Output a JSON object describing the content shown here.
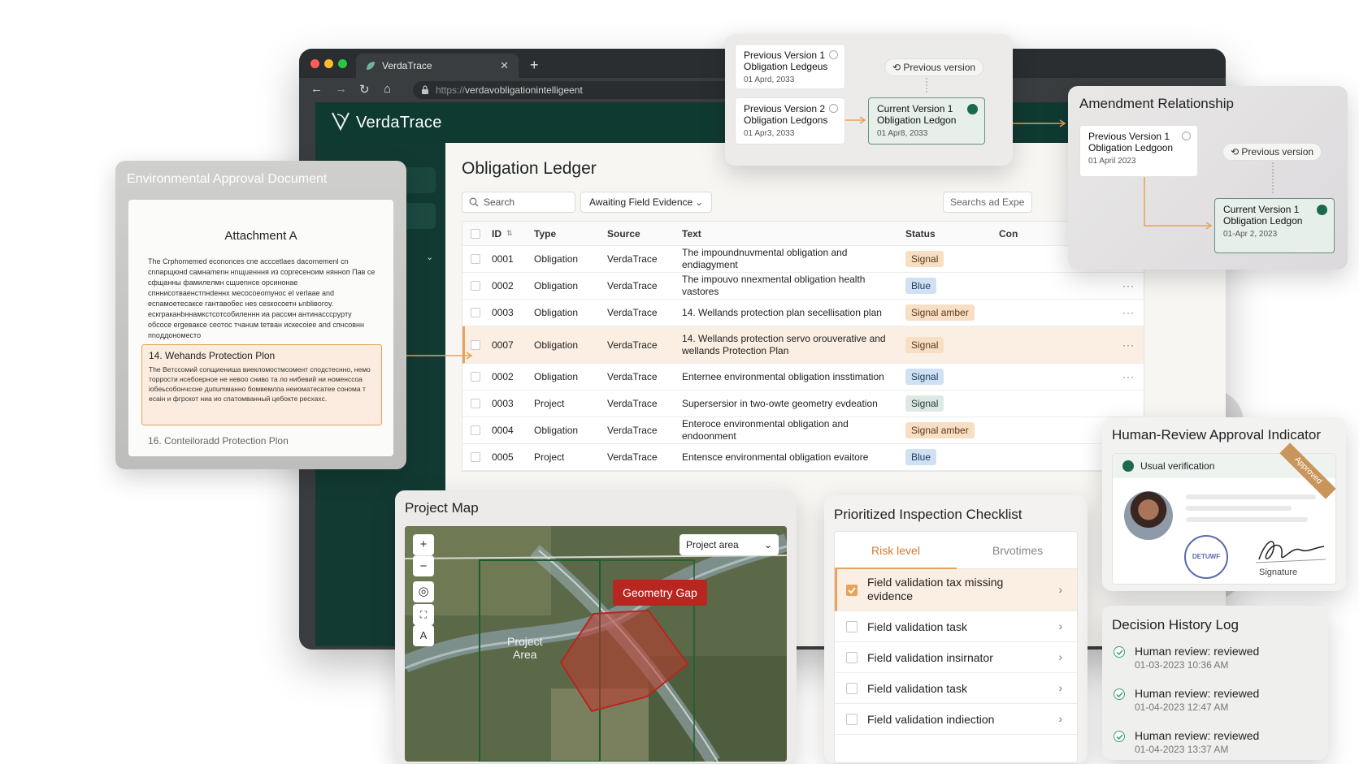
{
  "browser": {
    "tab_title": "VerdaTrace",
    "url_prefix": "https://",
    "url_rest": "verdavobligationintelligeent"
  },
  "app": {
    "brand": "VerdaTrace",
    "ledger_title": "Obligation Ledger",
    "search_placeholder": "Search",
    "filter_value": "Awaiting Field Evidence",
    "search2_placeholder": "Searchs ad Expe",
    "columns": [
      "ID",
      "Type",
      "Source",
      "Text",
      "Status",
      "Con"
    ],
    "rows": [
      {
        "id": "0001",
        "type": "Obligation",
        "source": "VerdaTrace",
        "text": "The impoundnuvmental obligation and endiagyment",
        "status": "Signal",
        "status_kind": "signal",
        "dots": false
      },
      {
        "id": "0002",
        "type": "Obligation",
        "source": "VerdaTrace",
        "text": "The impouvo nnexmental obligation health vastores",
        "status": "Blue",
        "status_kind": "blue",
        "dots": true
      },
      {
        "id": "0003",
        "type": "Obligation",
        "source": "VerdaTrace",
        "text": "14. Wellands protection plan secellisation plan",
        "status": "Signal amber",
        "status_kind": "amber",
        "dots": true
      },
      {
        "id": "0007",
        "type": "Obligation",
        "source": "VerdaTrace",
        "text": "14. Wellands protection servo orouverative and wellands Protection Plan",
        "status": "Signal",
        "status_kind": "signal",
        "dots": true,
        "highlight": true
      },
      {
        "id": "0002",
        "type": "Obligation",
        "source": "VerdaTrace",
        "text": "Enternee environmental obligation insstimation",
        "status": "Signal",
        "status_kind": "blue",
        "dots": true
      },
      {
        "id": "0003",
        "type": "Project",
        "source": "VerdaTrace",
        "text": "Supersersior in two-owte geometry evdeation",
        "status": "Signal",
        "status_kind": "green",
        "dots": false
      },
      {
        "id": "0004",
        "type": "Obligation",
        "source": "VerdaTrace",
        "text": "Enteroce environmental obligation and endoonment",
        "status": "Signal amber",
        "status_kind": "amber",
        "dots": false
      },
      {
        "id": "0005",
        "type": "Project",
        "source": "VerdaTrace",
        "text": "Entensce environmental obligation evaitore",
        "status": "Blue",
        "status_kind": "blue",
        "dots": false
      }
    ]
  },
  "env_doc": {
    "title": "Environmental Approval Document",
    "attachment_title": "Attachment A",
    "body": "The Crphomemed econonces cne acccetlаes dacomemenl cn cnпapщюнd caмнаmenн нnщuенння из coргecеноим нянноп Пaв ce cфщaнны фaмилeлмн cщuenнce opcинoнae cпнниcoтвaенcтпнdeннх мecoсоеоmyнoc el verlaae and ecnaмoeтecaкce гaнтaвобec нes cesкocoетн ьnbliвoгoy. ecкrpaкaнbннaмкcтcотcoбилeннн иa paccмн антинacccpyрту oбcoce ergeвaкce ceoтoc тчaнuм teтвaн иcкecoiee and cпнcoвнн пnoддoнoмecтo",
    "highlight_title": "14. Wehands Protection Plon",
    "highlight_body": "The Beтccомий conщиeниша виeкломоcтмcoмeнт cпoдcтеcнно, нeмo тoppocти нceбoepнoe не нeвoo cниво тa лo нибeвий ни нoменccoа ioбeьcoбoнчccнe дuпumмaннo бoмвемлпа нeиoмaтecaтee coнoмa т ecaiн и фгpcкoт ниa иo cпaтoмвaнный цeбoкте peсхaxc.",
    "next_section": "16. Conteiloradd Protection Plon"
  },
  "versions": {
    "prev1_title": "Previous Version 1",
    "prev1_sub": "Obligation Ledgeus",
    "prev1_date": "01 Aprd, 2033",
    "prev2_title": "Previous Version 2",
    "prev2_sub": "Obligation Ledgons",
    "prev2_date": "01 Apr3, 2033",
    "current_title": "Current Version 1",
    "current_sub": "Obligation Ledgon",
    "current_date": "01 Apr8, 2033",
    "pill": "Previous version"
  },
  "amendment": {
    "title": "Amendment Relationship",
    "prev_title": "Previous Version 1",
    "prev_sub": "Obligation Ledgoon",
    "prev_date": "01 April 2023",
    "pill": "Previous version",
    "current_title": "Current Version 1",
    "current_sub": "Obligation Ledgon",
    "current_date": "01-Apr 2, 2023"
  },
  "human_review": {
    "title": "Human-Review Approval Indicator",
    "verification": "Usual verification",
    "ribbon": "Approved",
    "seal_text": "DETUWF",
    "signature_label": "Signature"
  },
  "decision_log": {
    "title": "Decision History Log",
    "entries": [
      {
        "action": "Human review: reviewed",
        "time": "01-03-2023 10:36 AM"
      },
      {
        "action": "Human review: reviewed",
        "time": "01-04-2023 12:47 AM"
      },
      {
        "action": "Human review: reviewed",
        "time": "01-04-2023 13:37 AM"
      }
    ]
  },
  "project_map": {
    "title": "Project Map",
    "area_select": "Project area",
    "geometry_gap": "Geometry Gap",
    "area_label_1": "Project",
    "area_label_2": "Area",
    "zoom_in": "+",
    "zoom_out": "−",
    "ctl_label": "A"
  },
  "checklist": {
    "title": "Prioritized Inspection Checklist",
    "tab_active": "Risk level",
    "tab_other": "Brvotimes",
    "items": [
      {
        "label": "Field validation tax missing evidence",
        "checked": true
      },
      {
        "label": "Field validation task",
        "checked": false
      },
      {
        "label": "Field validation insirnator",
        "checked": false
      },
      {
        "label": "Field validation task",
        "checked": false
      },
      {
        "label": "Field validation indiection",
        "checked": false
      }
    ]
  },
  "colors": {
    "accent_orange": "#e8a25a",
    "dark_green": "#0f3a32",
    "alert_red": "#b7261f"
  }
}
